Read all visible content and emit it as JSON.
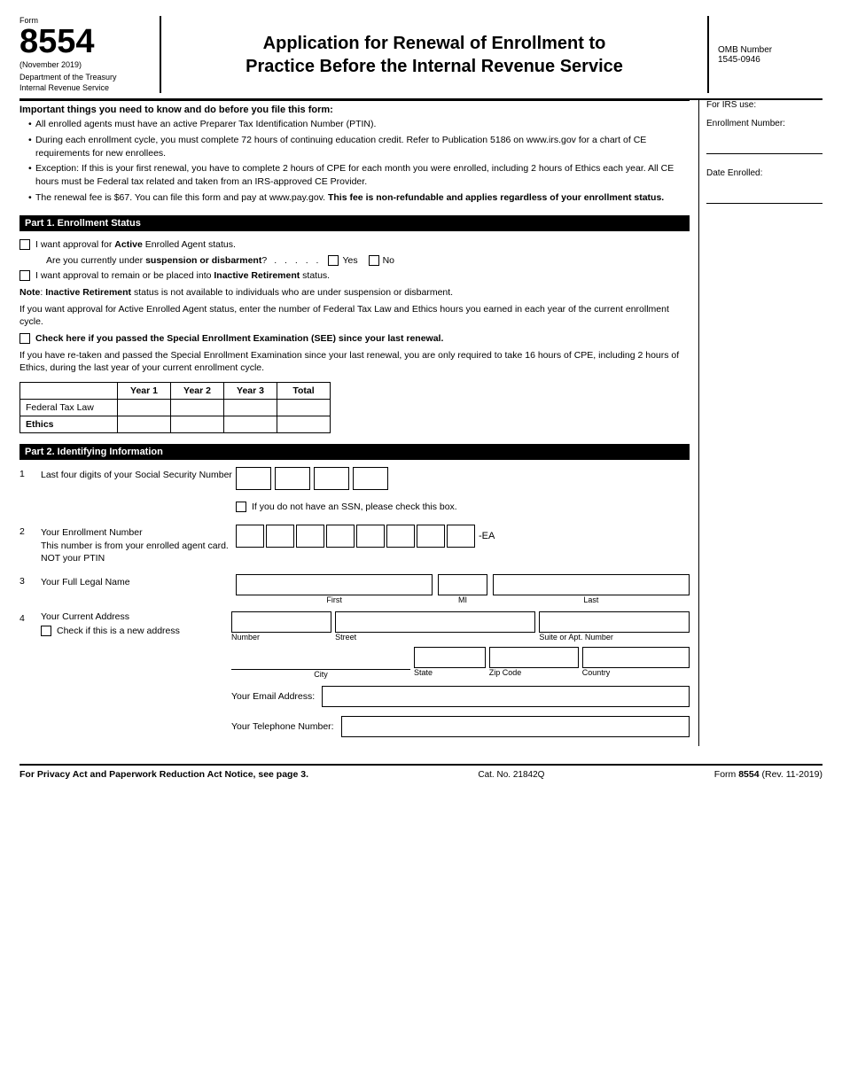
{
  "form": {
    "number_label": "Form",
    "number": "8554",
    "date": "(November 2019)",
    "department_line1": "Department of the Treasury",
    "department_line2": "Internal Revenue Service",
    "title_line1": "Application for Renewal of Enrollment to",
    "title_line2": "Practice Before the Internal Revenue Service",
    "omb_label": "OMB Number",
    "omb_number": "1545-0946"
  },
  "irs_use": {
    "title": "For IRS use:",
    "enrollment_label": "Enrollment Number:",
    "date_label": "Date Enrolled:"
  },
  "important": {
    "title": "Important things you need to know and do before you file this form:",
    "bullets": [
      "All enrolled agents must have an active Preparer Tax Identification Number (PTIN).",
      "During each enrollment cycle, you must complete 72 hours of continuing education credit. Refer to Publication 5186 on www.irs.gov for a chart of CE requirements for new enrollees.",
      "Exception: If this is your first renewal, you have to complete 2 hours of CPE for each month you were enrolled, including 2 hours of Ethics each year. All CE hours must be Federal tax related and taken from an IRS-approved CE Provider.",
      "The renewal fee is $67. You can file this form and pay at www.pay.gov. This fee is non-refundable and applies regardless of your enrollment status."
    ],
    "bullet4_bold_start": "This fee is non-refundable and applies regardless of your enrollment status."
  },
  "part1": {
    "header": "Part 1. Enrollment Status",
    "active_label": "I want approval for ",
    "active_bold": "Active",
    "active_label2": " Enrolled Agent status.",
    "suspension_label": "Are you currently under ",
    "suspension_bold": "suspension or disbarment",
    "suspension_label2": "?",
    "dots": ". . . . .",
    "yes_label": "Yes",
    "no_label": "No",
    "inactive_label": "I want approval to remain or be placed into ",
    "inactive_bold": "Inactive Retirement",
    "inactive_label2": " status.",
    "note_label": "Note",
    "note_colon": ": ",
    "note_bold": "Inactive Retirement",
    "note_text": " status is not available to individuals who are under suspension or disbarment.",
    "cpe_text": "If you want approval for Active Enrolled Agent status, enter the number of Federal Tax Law and Ethics hours you earned in each year of the current enrollment cycle.",
    "see_check_label": "Check here if you passed the Special Enrollment Examination (SEE) since your last renewal.",
    "cpe_text2": "If you have re-taken and passed the Special Enrollment Examination since your last renewal, you are only required to take 16 hours of CPE, including 2 hours of Ethics, during the last year of your current enrollment cycle.",
    "table": {
      "headers": [
        "",
        "Year 1",
        "Year 2",
        "Year 3",
        "Total"
      ],
      "rows": [
        {
          "label": "Federal Tax Law",
          "year1": "",
          "year2": "",
          "year3": "",
          "total": ""
        },
        {
          "label": "Ethics",
          "year1": "",
          "year2": "",
          "year3": "",
          "total": ""
        }
      ]
    }
  },
  "part2": {
    "header": "Part 2. Identifying Information",
    "field1": {
      "number": "1",
      "label": "Last four digits of your Social Security Number",
      "ssn_count": 4,
      "no_ssn_text": "If you do not have an SSN, please check this box."
    },
    "field2": {
      "number": "2",
      "label_line1": "Your Enrollment Number",
      "label_line2": "This number is from your enrolled agent card.",
      "label_line3": "NOT your PTIN",
      "box_count": 8,
      "suffix": "-EA"
    },
    "field3": {
      "number": "3",
      "label": "Your Full Legal Name",
      "sublabels": [
        "First",
        "MI",
        "Last"
      ]
    },
    "field4": {
      "number": "4",
      "label": "Your Current Address",
      "check_label": "Check if this is a new address",
      "sublabels_row1": [
        "Number",
        "Street",
        "Suite or Apt. Number"
      ],
      "sublabels_row2": [
        "City",
        "State",
        "Zip Code",
        "Country"
      ],
      "email_label": "Your Email Address:",
      "phone_label": "Your Telephone Number:"
    }
  },
  "footer": {
    "privacy_text": "For Privacy Act and Paperwork Reduction Act Notice, see page 3.",
    "cat_text": "Cat. No. 21842Q",
    "form_ref": "Form 8554 (Rev. 11-2019)"
  }
}
